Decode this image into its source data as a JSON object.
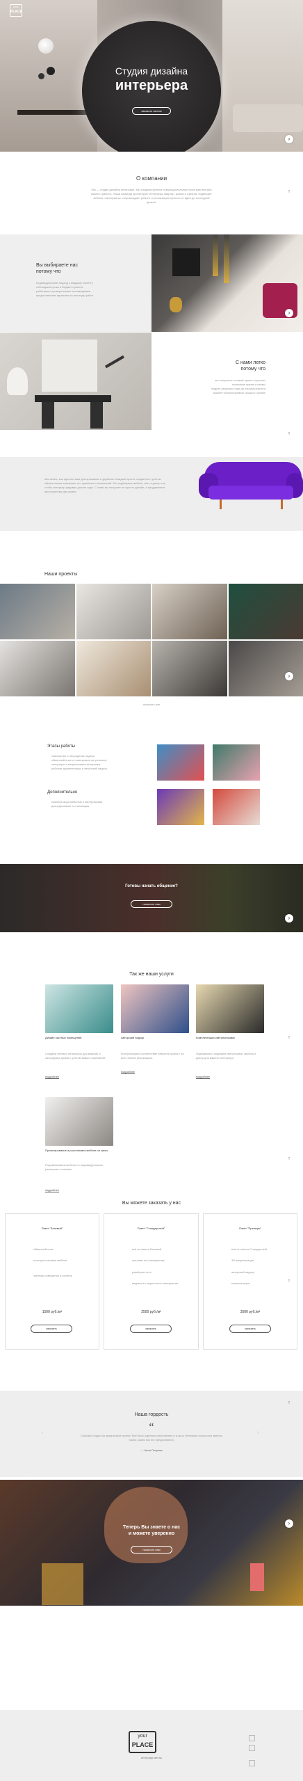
{
  "header": {
    "logo_top": "your",
    "logo_bottom": "PLACE",
    "title_line1": "Студия дизайна",
    "title_line2": "интерьера",
    "cta": "заказать звонок"
  },
  "about": {
    "title": "О компании",
    "text": "Мы — студия дизайна интерьера. Мы создаём уютные и функциональные пространства для жизни и работы. Наша команда проектирует интерьеры квартир, домов и офисов, подбирает мебель и материалы, сопровождает ремонт и реализацию проекта от идеи до последней детали."
  },
  "choose": {
    "title_line1": "Вы выбираете нас",
    "title_line2": "потому что",
    "items": [
      "индивидуальный подход к каждому клиенту",
      "соблюдаем сроки и бюджет проекта",
      "работаем с проверенными поставщиками",
      "предоставляем гарантию на все виды работ"
    ]
  },
  "easy": {
    "title_line1": "С нами легко",
    "title_line2": "потому что",
    "items": [
      "вы получаете готовый проект под ключ",
      "экономите время и нервы",
      "видите результат ещё до начала ремонта",
      "можете контролировать процесс онлайн"
    ]
  },
  "sofa_block": {
    "text": "Мы знаем, как сделать ваш дом красивым и удобным. Каждый проект создаётся с учётом образа жизни заказчика, его привычек и пожеланий. Мы подбираем мебель, свет и декор так, чтобы интерьер радовал долгие годы. С нами вы получите не просто дизайн, а продуманное пространство для жизни."
  },
  "projects": {
    "title": "Наши проекты",
    "more": "смотреть все"
  },
  "stages": {
    "title": "Этапы работы",
    "items": [
      "знакомство и обсуждение задачи",
      "обмерный план и планировочное решение",
      "концепция и визуализация интерьера",
      "рабочая документация и авторский надзор"
    ],
    "extra_title": "Дополнительно",
    "extra_items": [
      "комплектация мебелью и материалами",
      "декорирование и стилизация"
    ]
  },
  "contact_banner": {
    "title": "Готовы начать общение?",
    "cta": "написать нам"
  },
  "services": {
    "title": "Так же наши услуги",
    "items": [
      {
        "name": "Дизайн частных помещений",
        "text": "Создаём уютные интерьеры для квартир и загородных домов с учётом ваших пожеланий.",
        "more": "подробнее"
      },
      {
        "name": "Авторский надзор",
        "text": "Контролируем соответствие ремонта проекту на всех этапах реализации.",
        "more": "подробнее"
      },
      {
        "name": "Комплектация светильниками",
        "text": "Подбираем и закупаем светильники, мебель и декор для вашего интерьера.",
        "more": "подробнее"
      },
      {
        "name": "Проектирование и расстановка мебели на заказ",
        "text": "Разрабатываем мебель по индивидуальным размерам и эскизам.",
        "more": "подробнее"
      }
    ]
  },
  "pricing": {
    "title": "Вы можете заказать у нас",
    "plans": [
      {
        "name": "Пакет \"Базовый\"",
        "features": [
          "обмерный план",
          "план расстановки мебели",
          "чертежи освещения и розеток"
        ],
        "price": "1500 руб./м²",
        "cta": "заказать"
      },
      {
        "name": "Пакет \"Стандартный\"",
        "features": [
          "всё из пакета Базовый",
          "коллажи по помещениям",
          "развёртки стен",
          "ведомость отделочных материалов"
        ],
        "price": "2500 руб./м²",
        "cta": "заказать"
      },
      {
        "name": "Пакет \"Премиум\"",
        "features": [
          "всё из пакета Стандартный",
          "3D-визуализация",
          "авторский надзор",
          "комплектация"
        ],
        "price": "3500 руб./м²",
        "cta": "заказать"
      }
    ]
  },
  "pride": {
    "title": "Наша гордость",
    "quote_mark": "“",
    "text": "Спасибо студии за прекрасный проект! Всё было сделано качественно и в срок. Интерьер получился именно таким, каким мы его представляли.",
    "author": "— Анна Петрова",
    "prev": "‹",
    "next": "›"
  },
  "final_banner": {
    "title_line1": "Теперь Вы знаете о нас",
    "title_line2": "и можете уверенно",
    "cta": "написать нам"
  },
  "footer": {
    "logo_top": "your",
    "logo_bottom": "PLACE",
    "tagline": "интерьер мечты"
  },
  "ui": {
    "scroll_up": "↑",
    "slider_next": "›"
  }
}
